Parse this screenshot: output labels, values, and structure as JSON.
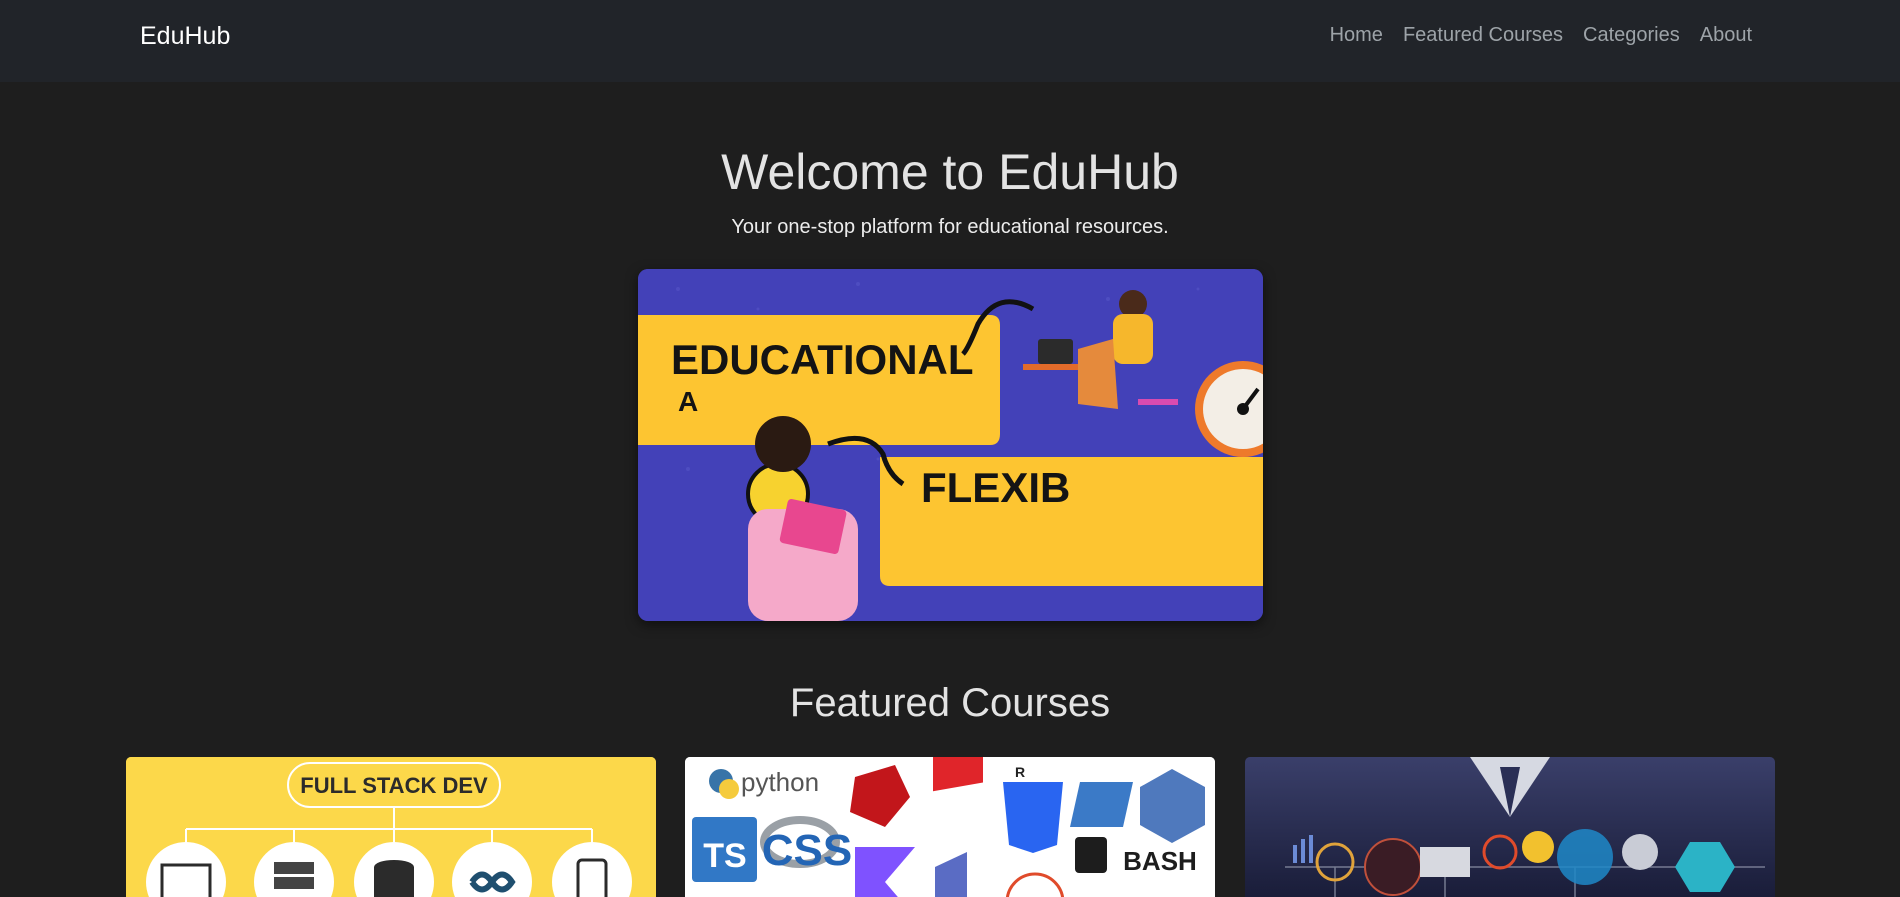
{
  "nav": {
    "brand": "EduHub",
    "links": [
      "Home",
      "Featured Courses",
      "Categories",
      "About"
    ]
  },
  "hero": {
    "title": "Welcome to EduHub",
    "subtitle": "Your one-stop platform for educational resources.",
    "banner_text": {
      "line1": "EDUCATIONAL",
      "line2": "A",
      "line3": "FLEXIB"
    }
  },
  "featured": {
    "title": "Featured Courses",
    "card1": {
      "label": "FULL STACK DEV"
    },
    "card2": {
      "labels": [
        "python",
        "TS",
        "R",
        "CSS",
        "BASH"
      ]
    }
  },
  "colors": {
    "page_bg": "#1e1e1e",
    "navbar_bg": "#212429",
    "banner_bg": "#3f3eb5",
    "banner_yellow": "#fdc531",
    "card1_bg": "#fcd84a"
  }
}
